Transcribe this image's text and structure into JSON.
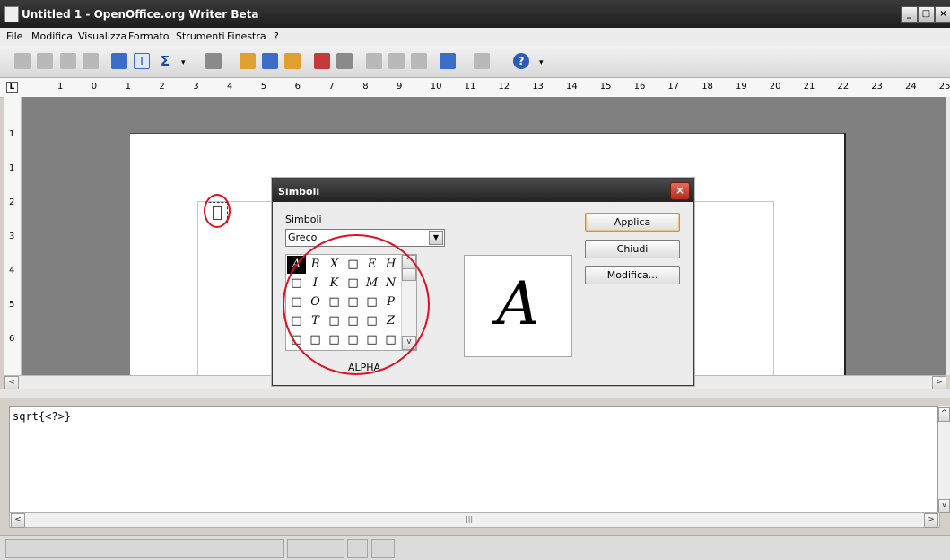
{
  "window": {
    "title": "Untitled 1 - OpenOffice.org Writer Beta",
    "minimize": "_",
    "maximize": "□",
    "close": "×"
  },
  "menu": [
    "File",
    "Modifica",
    "Visualizza",
    "Formato",
    "Strumenti",
    "Finestra",
    "?"
  ],
  "toolbar": {
    "help_glyph": "?",
    "cursor_glyph": "I",
    "sigma_glyph": "Σ",
    "overflow_glyph": "▾"
  },
  "ruler": {
    "corner": "L",
    "labels": [
      "1",
      "0",
      "1",
      "2",
      "3",
      "4",
      "5",
      "6",
      "7",
      "8",
      "9",
      "10",
      "11",
      "12",
      "13",
      "14",
      "15",
      "16",
      "17",
      "18",
      "19",
      "20",
      "21",
      "22",
      "23",
      "24",
      "25"
    ],
    "vertical_labels": [
      "1",
      "1",
      "2",
      "3",
      "4",
      "5",
      "6"
    ]
  },
  "dialog": {
    "title": "Simboli",
    "close_glyph": "×",
    "symbol_set_label": "Simboli",
    "symbol_set_value": "Greco",
    "grid": [
      [
        "A",
        "B",
        "X",
        "□",
        "E",
        "H"
      ],
      [
        "□",
        "I",
        "K",
        "□",
        "M",
        "N"
      ],
      [
        "□",
        "O",
        "□",
        "□",
        "□",
        "P"
      ],
      [
        "□",
        "T",
        "□",
        "□",
        "□",
        "Z"
      ],
      [
        "□",
        "□",
        "□",
        "□",
        "□",
        "□"
      ]
    ],
    "selected_symbol_name": "ALPHA",
    "preview_glyph": "A",
    "buttons": {
      "apply": "Applica",
      "close": "Chiudi",
      "edit": "Modifica..."
    }
  },
  "formula": {
    "text": "sqrt{<?>}"
  },
  "scroll": {
    "left": "<",
    "right": ">",
    "up": "^",
    "down": "v",
    "thumb": "|||"
  }
}
